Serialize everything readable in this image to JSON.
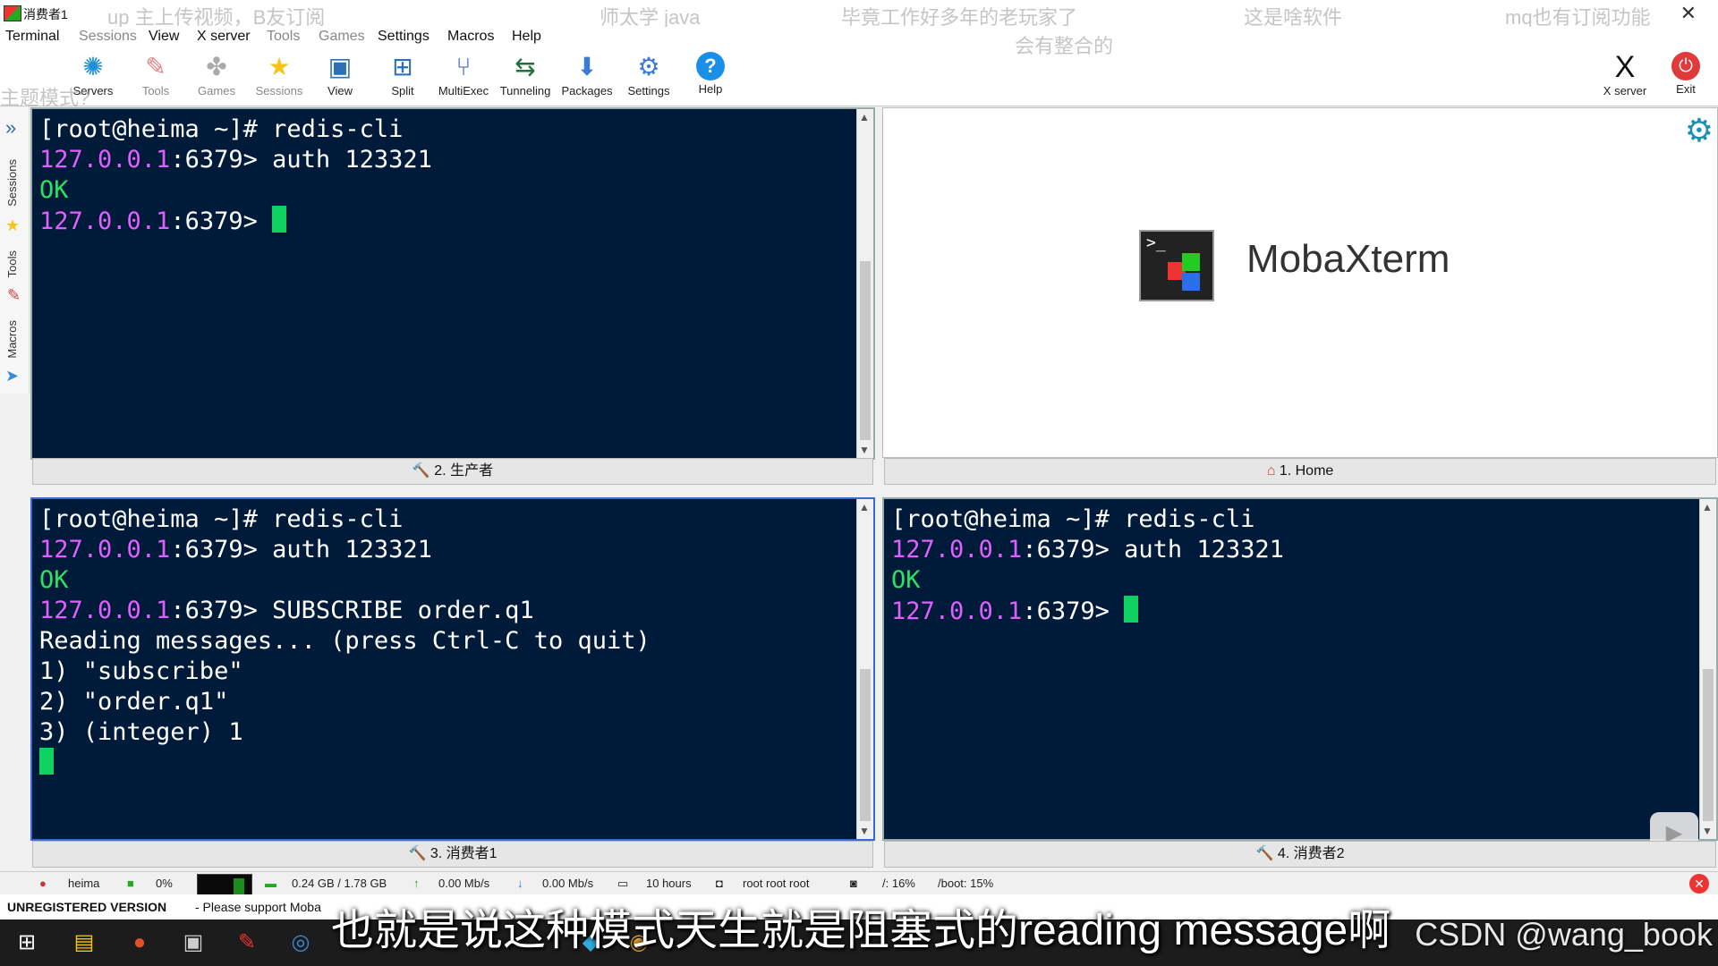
{
  "window": {
    "title": "消费者1",
    "close_glyph": "✕"
  },
  "overlays": [
    "up  主上传视频，B友订阅",
    "师太学 java",
    "毕竟工作好多年的老玩家了",
    "会有整合的",
    "这是啥软件",
    "mq也有订阅功能",
    "主题模式?"
  ],
  "menu": [
    "Terminal",
    "Sessions",
    "View",
    "X server",
    "Tools",
    "Games",
    "Settings",
    "Macros",
    "Help"
  ],
  "toolbar": [
    {
      "label": "Servers",
      "icon": "servers-icon"
    },
    {
      "label": "Tools",
      "icon": "tools-icon"
    },
    {
      "label": "Games",
      "icon": "games-icon"
    },
    {
      "label": "Sessions",
      "icon": "star-icon"
    },
    {
      "label": "View",
      "icon": "view-icon"
    },
    {
      "label": "Split",
      "icon": "split-icon"
    },
    {
      "label": "MultiExec",
      "icon": "multiexec-icon"
    },
    {
      "label": "Tunneling",
      "icon": "tunneling-icon"
    },
    {
      "label": "Packages",
      "icon": "packages-icon"
    },
    {
      "label": "Settings",
      "icon": "gear-icon"
    },
    {
      "label": "Help",
      "icon": "help-icon"
    }
  ],
  "toolbar_right": [
    {
      "label": "X server",
      "icon": "xserver-icon"
    },
    {
      "label": "Exit",
      "icon": "power-icon"
    }
  ],
  "sidebar": [
    "Sessions",
    "Tools",
    "Macros"
  ],
  "panes": {
    "top_left": {
      "tab": "2. 生产者",
      "lines": [
        {
          "pre": "",
          "ip": "",
          "text": "[root@heima ~]# redis-cli",
          "ok": ""
        },
        {
          "pre": "",
          "ip": "127.0.0.1",
          "text": ":6379> auth 123321",
          "ok": ""
        },
        {
          "pre": "",
          "ip": "",
          "text": "",
          "ok": "OK"
        },
        {
          "pre": "",
          "ip": "127.0.0.1",
          "text": ":6379> ",
          "ok": ""
        }
      ]
    },
    "top_right": {
      "tab": "1. Home",
      "brand": "MobaXterm"
    },
    "bottom_left": {
      "tab": "3. 消费者1",
      "lines": [
        "[root@heima ~]# redis-cli",
        ":6379> auth 123321",
        "OK",
        ":6379> SUBSCRIBE order.q1",
        "Reading messages... (press Ctrl-C to quit)",
        "1) \"subscribe\"",
        "2) \"order.q1\"",
        "3) (integer) 1"
      ]
    },
    "bottom_right": {
      "tab": "4. 消费者2",
      "lines": [
        "[root@heima ~]# redis-cli",
        ":6379> auth 123321",
        "OK",
        ":6379> "
      ]
    },
    "ip": "127.0.0.1"
  },
  "statusbar": {
    "host": "heima",
    "cpu": "0%",
    "mem": "0.24 GB / 1.78 GB",
    "up": "0.00 Mb/s",
    "down": "0.00 Mb/s",
    "uptime": "10 hours",
    "users": "root  root  root",
    "disk1": "/: 16%",
    "disk2": "/boot: 15%"
  },
  "unregistered": {
    "label": "UNREGISTERED VERSION",
    "support": "-  Please support Moba"
  },
  "subtitle": "也就是说这种模式天生就是阻塞式的reading message啊",
  "watermark": "CSDN @wang_book",
  "colors": {
    "terminal_bg": "#001b3a",
    "ip": "#e060ff",
    "ok": "#30e060",
    "cursor": "#10d060"
  }
}
